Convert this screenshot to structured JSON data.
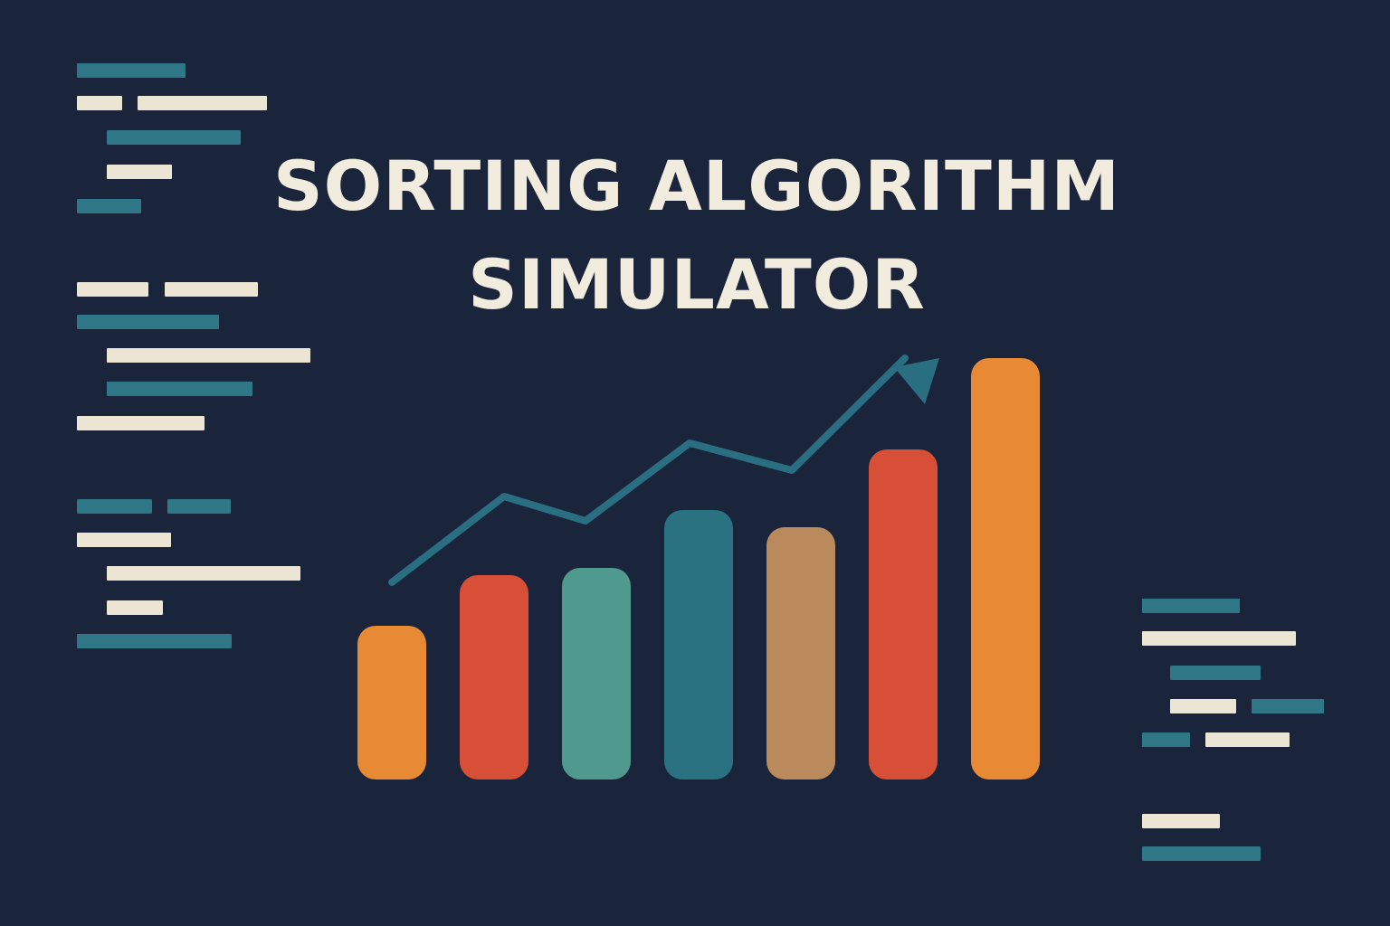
{
  "colors": {
    "background": "#1a253b",
    "title": "#f2ecdf",
    "code_cream": "#ede5d4",
    "code_teal": "#2f7686",
    "trend_line": "#2a6e82"
  },
  "title": {
    "line1": "SORTING ALGORITHM",
    "line2": "SIMULATOR"
  },
  "decorations": {
    "trend_arrow_icon": "arrow-up-right-icon"
  },
  "chart_data": {
    "type": "bar",
    "values": [
      170,
      226,
      234,
      298,
      279,
      365,
      466
    ],
    "colors": [
      "#e88933",
      "#d64f36",
      "#4f998f",
      "#2a7282",
      "#ba8a5d",
      "#d64f36",
      "#e88933"
    ],
    "trend": [
      218,
      313,
      286,
      372,
      342,
      466
    ],
    "ylim": [
      0,
      480
    ],
    "grid": false,
    "legend": "none"
  }
}
